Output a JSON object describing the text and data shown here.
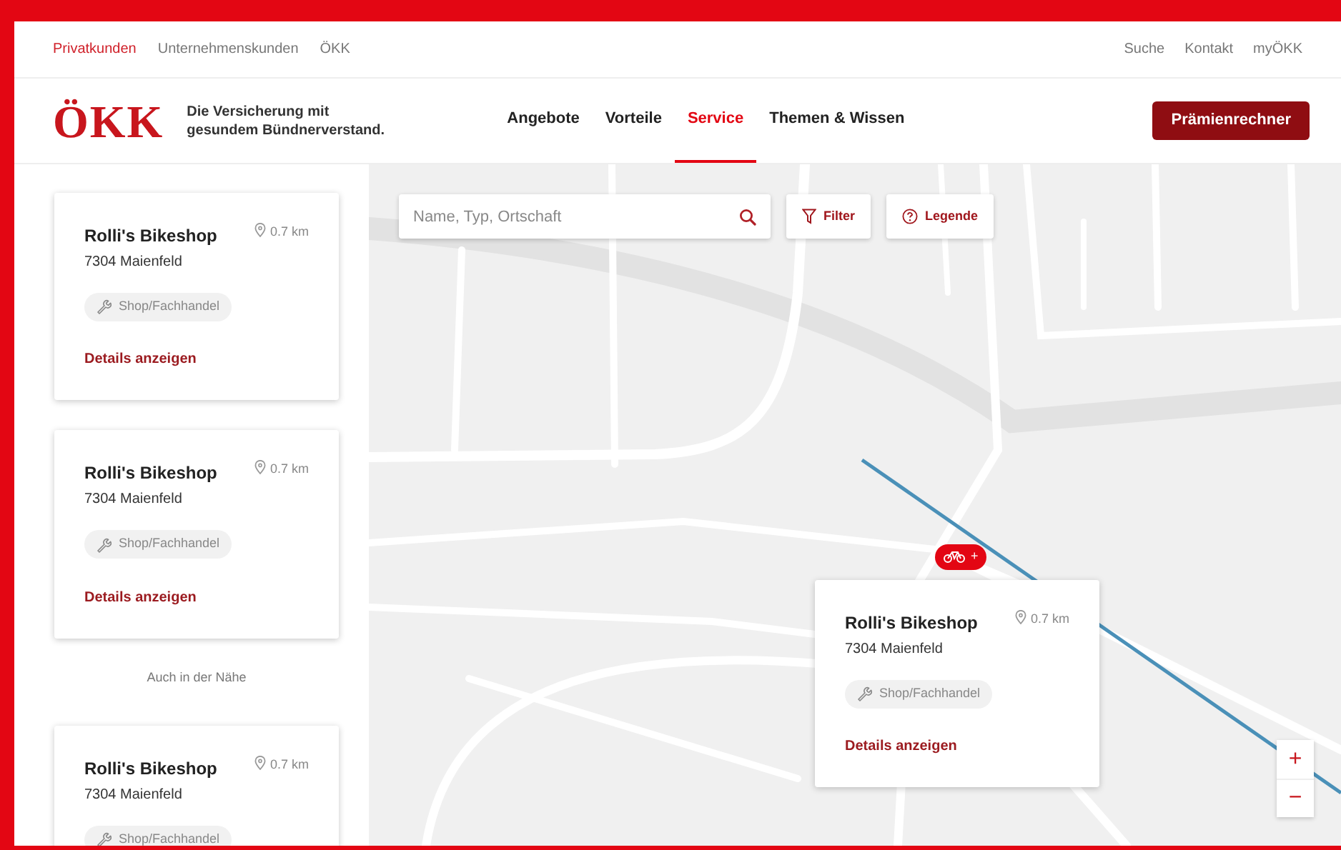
{
  "top_nav": {
    "left": [
      {
        "label": "Privatkunden",
        "selected": true
      },
      {
        "label": "Unternehmenskunden",
        "selected": false
      },
      {
        "label": "ÖKK",
        "selected": false
      }
    ],
    "right": [
      "Suche",
      "Kontakt",
      "myÖKK"
    ]
  },
  "header": {
    "logo": "ÖKK",
    "tagline": "Die Versicherung mit gesundem Bündnerverstand.",
    "nav": [
      {
        "label": "Angebote",
        "selected": false
      },
      {
        "label": "Vorteile",
        "selected": false
      },
      {
        "label": "Service",
        "selected": true
      },
      {
        "label": "Themen & Wissen",
        "selected": false
      }
    ],
    "cta": "Prämienrechner"
  },
  "results": [
    {
      "name": "Rolli's Bikeshop",
      "distance": "0.7 km",
      "address": "7304 Maienfeld",
      "tag": "Shop/Fachhandel",
      "link": "Details anzeigen"
    },
    {
      "name": "Rolli's Bikeshop",
      "distance": "0.7 km",
      "address": "7304 Maienfeld",
      "tag": "Shop/Fachhandel",
      "link": "Details anzeigen"
    }
  ],
  "nearby_heading": "Auch in der Nähe",
  "nearby": [
    {
      "name": "Rolli's Bikeshop",
      "distance": "0.7 km",
      "address": "7304 Maienfeld",
      "tag": "Shop/Fachhandel"
    }
  ],
  "map": {
    "search": {
      "placeholder": "Name, Typ, Ortschaft"
    },
    "filter_button": "Filter",
    "legend_button": "Legende",
    "marker": {
      "label": "+"
    },
    "popup": {
      "name": "Rolli's Bikeshop",
      "distance": "0.7 km",
      "address": "7304 Maienfeld",
      "tag": "Shop/Fachhandel",
      "link": "Details anzeigen"
    },
    "zoom": {
      "in": "+",
      "out": "−"
    }
  }
}
